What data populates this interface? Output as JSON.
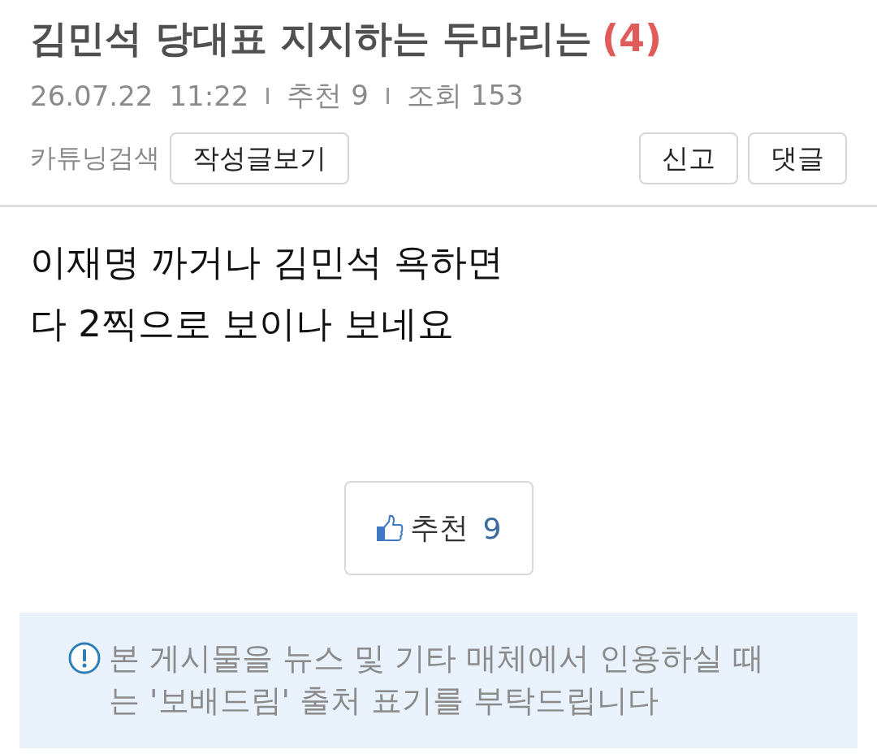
{
  "post": {
    "title": "김민석 당대표 지지하는 두마리는",
    "comment_count": "(4)"
  },
  "meta": {
    "date": "26.07.22",
    "time": "11:22",
    "stats": [
      "추천 9",
      "조회 153"
    ]
  },
  "actions": {
    "label": "카튜닝검색",
    "left_buttons": [
      "작성글보기"
    ],
    "right_buttons": [
      "신고",
      "댓글"
    ]
  },
  "body": {
    "lines": [
      "이재명 까거나 김민석 욕하면",
      "다 2찍으로 보이나 보네요"
    ]
  },
  "recommend": {
    "label": "추천",
    "count": "9"
  },
  "notice": {
    "text": "본 게시물을 뉴스 및 기타 매체에서 인용하실 때는 '보배드림' 출처 표기를 부탁드립니다"
  }
}
